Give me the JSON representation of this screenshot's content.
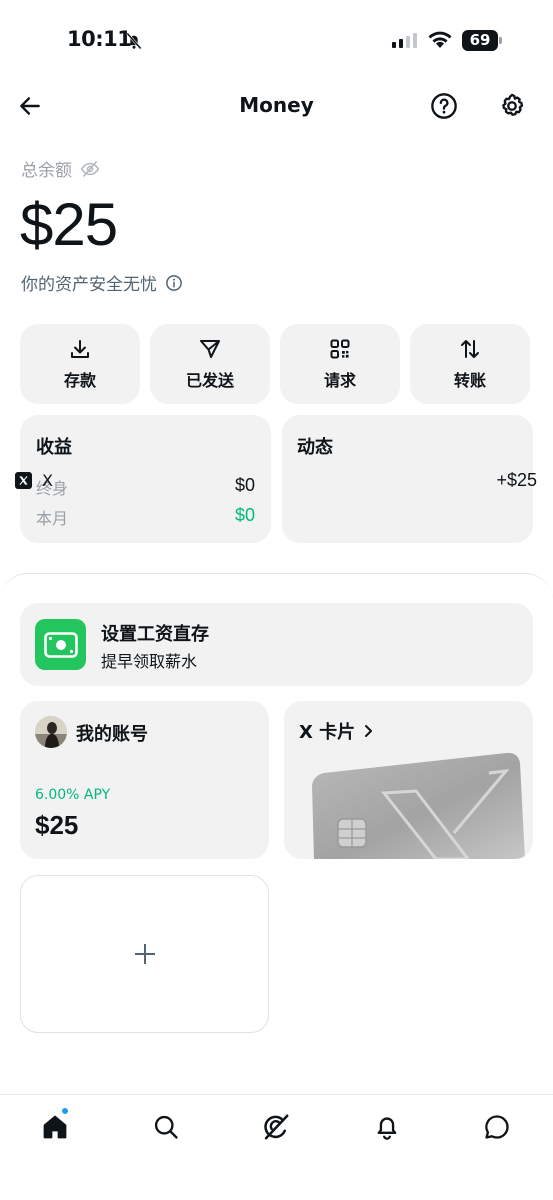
{
  "status_bar": {
    "time": "10:11",
    "battery": "69"
  },
  "header": {
    "title": "Money"
  },
  "balance": {
    "label": "总余额",
    "amount": "$25",
    "safety_note": "你的资产安全无忧"
  },
  "actions": [
    {
      "label": "存款",
      "icon": "download-icon"
    },
    {
      "label": "已发送",
      "icon": "send-icon"
    },
    {
      "label": "请求",
      "icon": "qr-code-icon"
    },
    {
      "label": "转账",
      "icon": "transfer-icon"
    }
  ],
  "earnings": {
    "title": "收益",
    "rows": [
      {
        "label": "终身",
        "value": "$0"
      },
      {
        "label": "本月",
        "value": "$0"
      }
    ]
  },
  "activity": {
    "title": "动态",
    "items": [
      {
        "name": "X",
        "amount": "+$25"
      }
    ]
  },
  "direct_deposit": {
    "title": "设置工资直存",
    "subtitle": "提早领取薪水"
  },
  "account": {
    "title": "我的账号",
    "apy": "6.00% APY",
    "balance": "$25"
  },
  "x_card": {
    "title": "X 卡片"
  },
  "colors": {
    "accent_green": "#00ba7c",
    "deposit_icon_bg": "#22c55e",
    "notification_dot": "#1d9bf0",
    "tile_bg": "#f2f2f2"
  },
  "tabbar": [
    "home-icon",
    "search-icon",
    "grok-icon",
    "notifications-icon",
    "messages-icon"
  ]
}
